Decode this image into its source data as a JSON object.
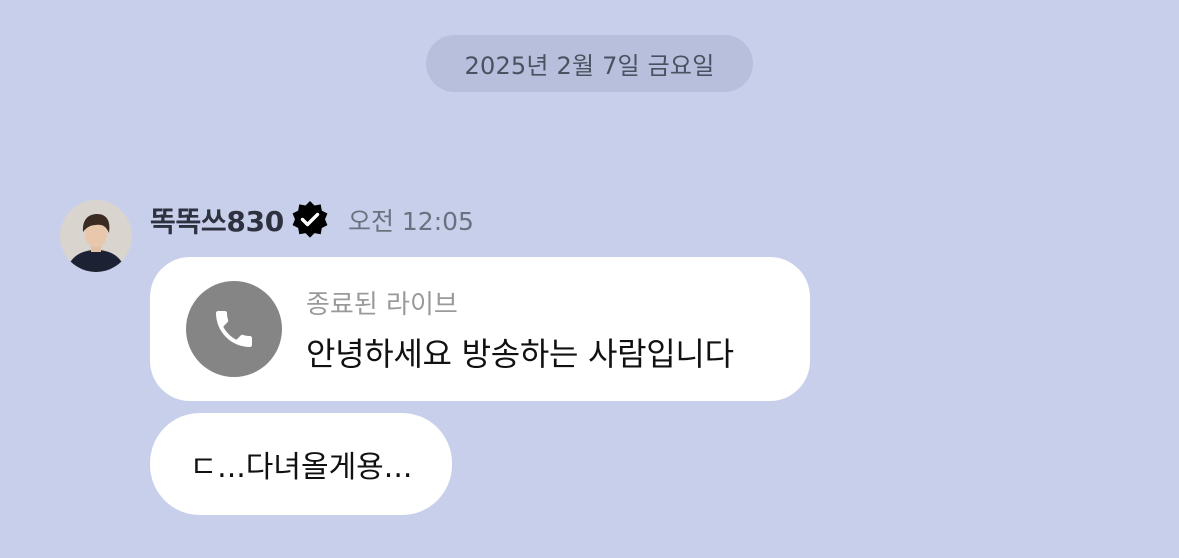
{
  "date_separator": "2025년 2월 7일 금요일",
  "message_group": {
    "sender": {
      "name": "똑똑쓰830",
      "verified_icon": "verified-badge-icon",
      "time": "오전 12:05"
    },
    "messages": [
      {
        "type": "call",
        "icon": "phone-icon",
        "label": "종료된 라이브",
        "title": "안녕하세요 방송하는 사람입니다"
      },
      {
        "type": "text",
        "text": "ㄷ...다녀올게용..."
      }
    ]
  },
  "colors": {
    "background": "#c8cfea",
    "date_pill": "#b8bfdc",
    "bubble": "#ffffff",
    "call_icon_bg": "#858585"
  }
}
